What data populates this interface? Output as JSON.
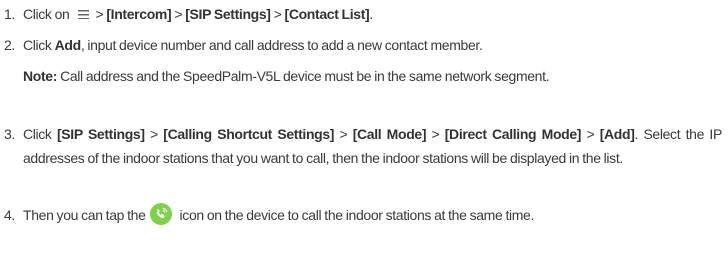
{
  "steps": [
    {
      "num": "1.",
      "click": "Click on",
      "sep": ">",
      "menu": [
        "[Intercom]",
        "[SIP Settings]",
        "[Contact List]"
      ],
      "end": "."
    },
    {
      "num": "2.",
      "click": "Click",
      "add": "Add",
      "rest": ", input device number and call address to add a new contact member.",
      "note_label": "Note:",
      "note_text": " Call address and the SpeedPalm-V5L device must be in the same network segment."
    },
    {
      "num": "3.",
      "click": "Click",
      "sep": ">",
      "menu": [
        "[SIP Settings]",
        "[Calling Shortcut Settings]",
        "[Call Mode]",
        "[Direct Calling Mode]",
        "[Add]"
      ],
      "rest": ". Select the IP addresses of the indoor stations that you want to call, then the indoor stations will be displayed in the list."
    },
    {
      "num": "4.",
      "pre": "Then you can tap the",
      "post": "icon on the device to call the indoor stations at the same time."
    }
  ],
  "icons": {
    "menu": "hamburger-menu-icon",
    "call": "call-icon",
    "call_color": "#7fd14a"
  }
}
